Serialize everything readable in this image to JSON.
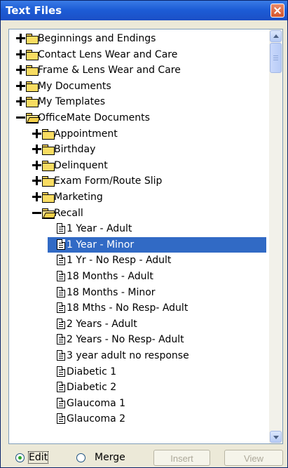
{
  "window": {
    "title": "Text Files",
    "close_icon": "close-icon"
  },
  "tree": {
    "items": [
      {
        "label": "Beginnings and Endings",
        "kind": "folder",
        "level": 0,
        "expanded": false,
        "selected": false
      },
      {
        "label": "Contact Lens Wear and Care",
        "kind": "folder",
        "level": 0,
        "expanded": false,
        "selected": false
      },
      {
        "label": "Frame & Lens Wear and Care",
        "kind": "folder",
        "level": 0,
        "expanded": false,
        "selected": false
      },
      {
        "label": "My Documents",
        "kind": "folder",
        "level": 0,
        "expanded": false,
        "selected": false
      },
      {
        "label": "My Templates",
        "kind": "folder",
        "level": 0,
        "expanded": false,
        "selected": false
      },
      {
        "label": "OfficeMate Documents",
        "kind": "folder",
        "level": 0,
        "expanded": true,
        "selected": false
      },
      {
        "label": "Appointment",
        "kind": "folder",
        "level": 1,
        "expanded": false,
        "selected": false
      },
      {
        "label": "Birthday",
        "kind": "folder",
        "level": 1,
        "expanded": false,
        "selected": false
      },
      {
        "label": "Delinquent",
        "kind": "folder",
        "level": 1,
        "expanded": false,
        "selected": false
      },
      {
        "label": "Exam Form/Route Slip",
        "kind": "folder",
        "level": 1,
        "expanded": false,
        "selected": false
      },
      {
        "label": "Marketing",
        "kind": "folder",
        "level": 1,
        "expanded": false,
        "selected": false
      },
      {
        "label": "Recall",
        "kind": "folder",
        "level": 1,
        "expanded": true,
        "selected": false
      },
      {
        "label": "1 Year - Adult",
        "kind": "file",
        "level": 2,
        "selected": false
      },
      {
        "label": "1 Year - Minor",
        "kind": "file",
        "level": 2,
        "selected": true
      },
      {
        "label": "1 Yr - No Resp - Adult",
        "kind": "file",
        "level": 2,
        "selected": false
      },
      {
        "label": "18 Months - Adult",
        "kind": "file",
        "level": 2,
        "selected": false
      },
      {
        "label": "18 Months - Minor",
        "kind": "file",
        "level": 2,
        "selected": false
      },
      {
        "label": "18 Mths - No Resp- Adult",
        "kind": "file",
        "level": 2,
        "selected": false
      },
      {
        "label": "2 Years - Adult",
        "kind": "file",
        "level": 2,
        "selected": false
      },
      {
        "label": "2 Years - No Resp- Adult",
        "kind": "file",
        "level": 2,
        "selected": false
      },
      {
        "label": "3 year adult no response",
        "kind": "file",
        "level": 2,
        "selected": false
      },
      {
        "label": "Diabetic 1",
        "kind": "file",
        "level": 2,
        "selected": false
      },
      {
        "label": "Diabetic 2",
        "kind": "file",
        "level": 2,
        "selected": false
      },
      {
        "label": "Glaucoma 1",
        "kind": "file",
        "level": 2,
        "selected": false
      },
      {
        "label": "Glaucoma 2",
        "kind": "file",
        "level": 2,
        "selected": false
      }
    ]
  },
  "bottom": {
    "edit_label": "Edit",
    "merge_label": "Merge",
    "mode_selected": "Edit",
    "insert_label": "Insert",
    "view_label": "View",
    "insert_enabled": false,
    "view_enabled": false
  },
  "colors": {
    "selection": "#316ac5",
    "titlebar": "#1d5dd6"
  }
}
